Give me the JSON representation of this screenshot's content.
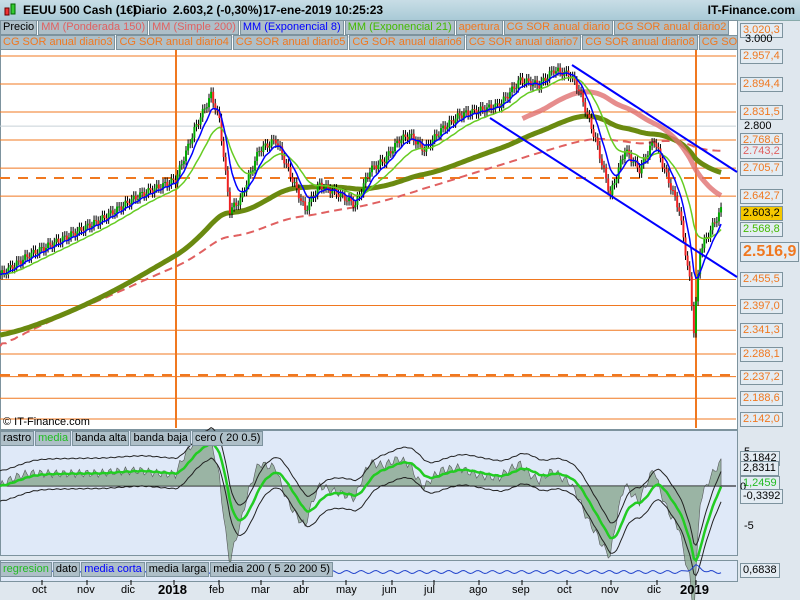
{
  "header": {
    "title": "EEUU 500 Cash (1€)",
    "period": "Diario",
    "price": "2.603,2 (-0,30%)",
    "datetime": "17-ene-2019 10:25:23",
    "brand": "IT-Finance.com"
  },
  "legend_row1": [
    {
      "label": "Precio",
      "color": "#000000"
    },
    {
      "label": "MM (Ponderada 150)",
      "color": "#e06060"
    },
    {
      "label": "MM (Simple 200)",
      "color": "#e06060"
    },
    {
      "label": "MM (Exponencial 8)",
      "color": "#0000ff"
    },
    {
      "label": "MM (Exponencial 21)",
      "color": "#44bb00"
    },
    {
      "label": "apertura",
      "color": "#f07820"
    },
    {
      "label": "CG SOR anual diario",
      "color": "#f07820"
    },
    {
      "label": "CG SOR anual diario2",
      "color": "#f07820"
    }
  ],
  "legend_row2": [
    "CG SOR anual diario3",
    "CG SOR anual diario4",
    "CG SOR anual diario5",
    "CG SOR anual diario6",
    "CG SOR anual diario7",
    "CG SOR anual diario8",
    "CG SOR anual di"
  ],
  "watermark": "© IT-Finance.com",
  "price_axis": {
    "top_label": "3.020,3",
    "grid_labels": [
      "3.000",
      "2.800"
    ],
    "levels": [
      "2.957,4",
      "2.894,4",
      "2.831,5",
      "2.768,6",
      "2.743,2",
      "2.705,7",
      "2.642,7",
      "2.568,8",
      "2.455,5",
      "2.397,0",
      "2.341,3",
      "2.288,1",
      "2.237,2",
      "2.188,6",
      "2.142,0"
    ],
    "current": "2.603,2",
    "highlight": "2.516,9"
  },
  "osc": {
    "legend": [
      "rastro",
      "media",
      "banda alta",
      "banda baja",
      "cero ( 20 0.5)"
    ],
    "labels": [
      "5",
      "3,1842",
      "2,8311",
      "1,2459",
      "0",
      "-0,3392",
      "-5"
    ]
  },
  "lower": {
    "legend": [
      "regresion",
      "dato",
      "media corta",
      "media larga",
      "media 200 ( 5 20 200 5)"
    ],
    "value": "0,6838"
  },
  "time_axis": [
    "oct",
    "nov",
    "dic",
    "2018",
    "feb",
    "mar",
    "abr",
    "may",
    "jun",
    "jul",
    "ago",
    "sep",
    "oct",
    "nov",
    "dic",
    "2019"
  ],
  "chart_data": {
    "type": "line",
    "title": "EEUU 500 Cash (1€) Diario",
    "ylim": [
      2120,
      3030
    ],
    "x": [
      0,
      14,
      29,
      48,
      67,
      84,
      93,
      101,
      105,
      110,
      115,
      124,
      132,
      139,
      146,
      153,
      163,
      170,
      177,
      184,
      191,
      196,
      203,
      211,
      220,
      230,
      239,
      249,
      258,
      265,
      273,
      277,
      285,
      292,
      299,
      306,
      313,
      318,
      325,
      330,
      332,
      335,
      340,
      345
    ],
    "close": [
      2465.5,
      2510.4,
      2544.1,
      2589.1,
      2645.2,
      2678.9,
      2791.2,
      2869.8,
      2813.7,
      2611.5,
      2634.0,
      2746.3,
      2768.7,
      2690.1,
      2611.5,
      2667.7,
      2645.2,
      2622.8,
      2701.4,
      2723.8,
      2768.7,
      2780.0,
      2746.3,
      2791.2,
      2824.9,
      2836.1,
      2847.3,
      2903.5,
      2892.3,
      2926.0,
      2914.7,
      2881.0,
      2768.7,
      2645.2,
      2746.3,
      2701.4,
      2768.7,
      2701.4,
      2611.5,
      2454.3,
      2342.0,
      2521.0,
      2566.6,
      2611.5
    ]
  }
}
